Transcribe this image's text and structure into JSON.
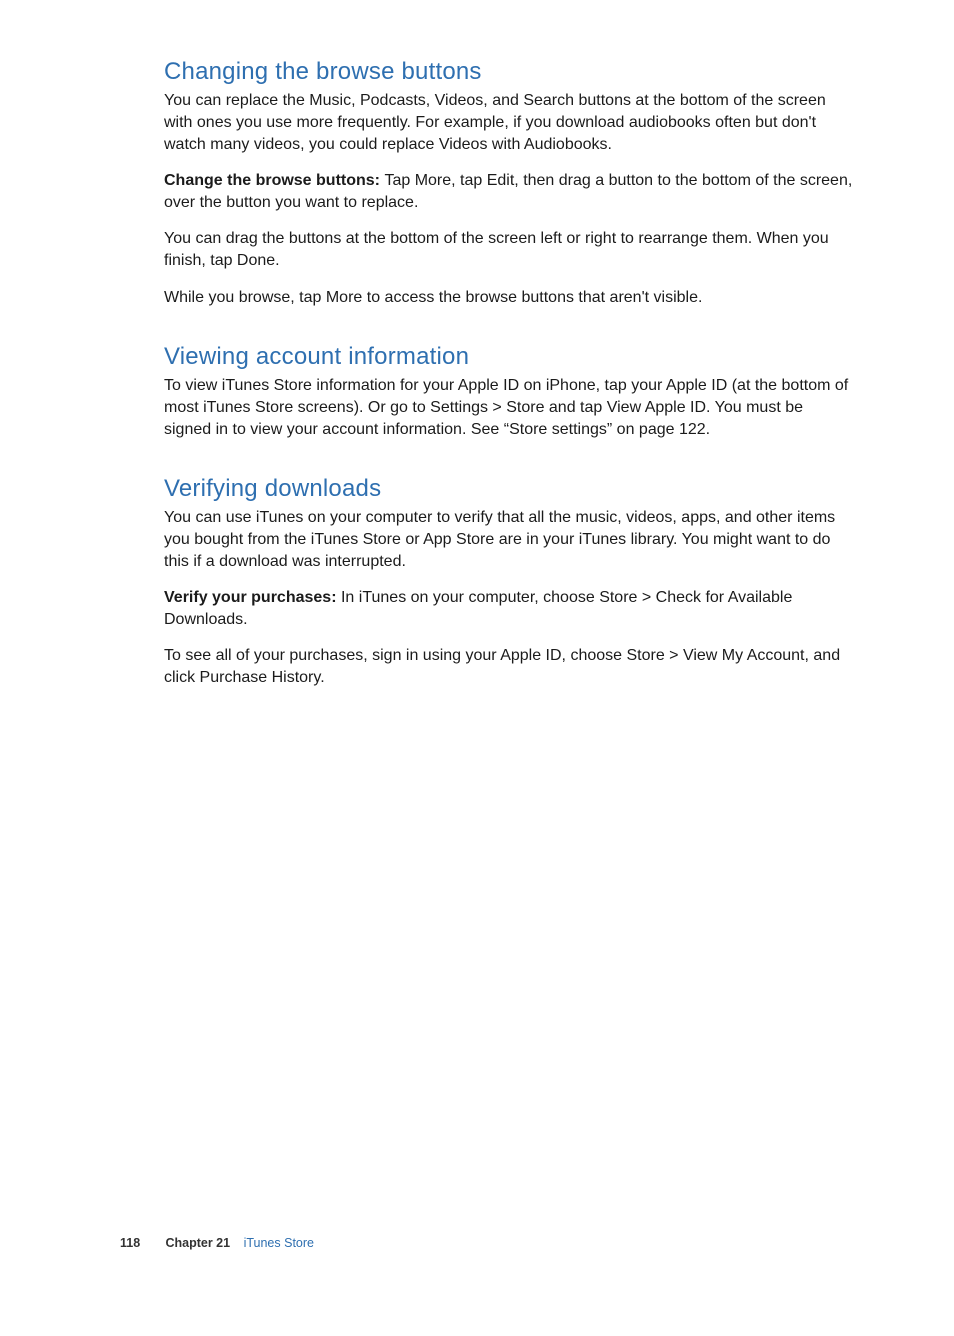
{
  "section1": {
    "heading": "Changing the browse buttons",
    "p1": "You can replace the Music, Podcasts, Videos, and Search buttons at the bottom of the screen with ones you use more frequently. For example, if you download audiobooks often but don't watch many videos, you could replace Videos with Audiobooks.",
    "p2_lead": "Change the browse buttons:  ",
    "p2_rest": "Tap More, tap Edit, then drag a button to the bottom of the screen, over the button you want to replace.",
    "p3": "You can drag the buttons at the bottom of the screen left or right to rearrange them. When you finish, tap Done.",
    "p4": "While you browse, tap More to access the browse buttons that aren't visible."
  },
  "section2": {
    "heading": "Viewing account information",
    "p1": "To view iTunes Store information for your Apple ID on iPhone, tap your Apple ID (at the bottom of most iTunes Store screens). Or go to Settings > Store and tap View Apple ID. You must be signed in to view your account information. See “Store settings” on page 122."
  },
  "section3": {
    "heading": "Verifying downloads",
    "p1": "You can use iTunes on your computer to verify that all the music, videos, apps, and other items you bought from the iTunes Store or App Store are in your iTunes library. You might want to do this if a download was interrupted.",
    "p2_lead": "Verify your purchases:  ",
    "p2_rest": "In iTunes on your computer, choose Store > Check for Available Downloads.",
    "p3": "To see all of your purchases, sign in using your Apple ID, choose Store > View My Account, and click Purchase History."
  },
  "footer": {
    "page": "118",
    "chapter_label": "Chapter 21",
    "chapter_title": "iTunes Store"
  }
}
